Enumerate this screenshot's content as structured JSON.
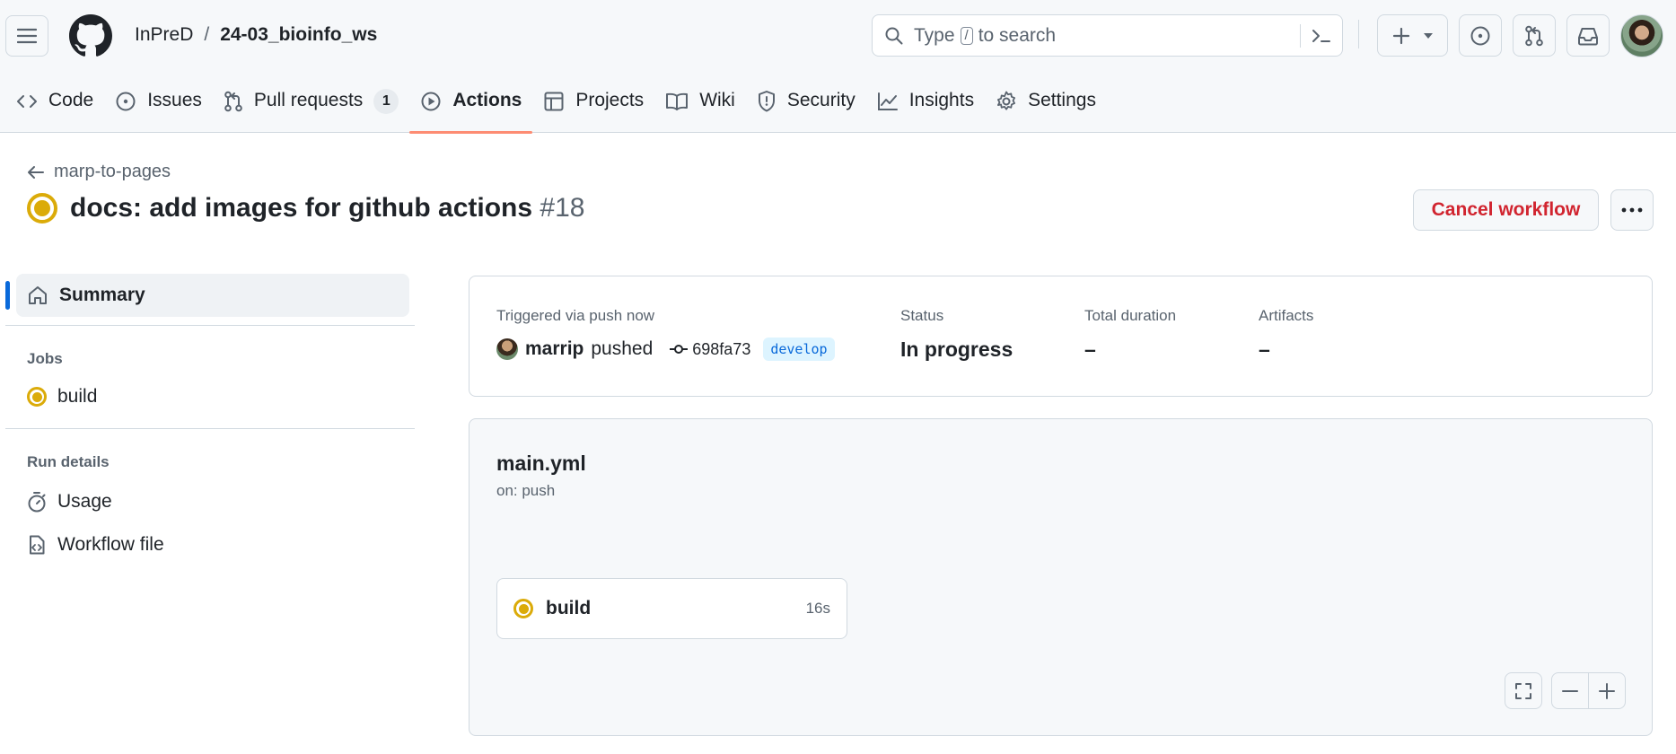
{
  "header": {
    "owner": "InPreD",
    "separator": "/",
    "repo": "24-03_bioinfo_ws",
    "search": {
      "text_before": "Type",
      "kbd": "/",
      "text_after": "to search"
    }
  },
  "tabs": [
    {
      "label": "Code",
      "icon": "code-icon"
    },
    {
      "label": "Issues",
      "icon": "issue-icon"
    },
    {
      "label": "Pull requests",
      "icon": "pull-request-icon",
      "count": "1"
    },
    {
      "label": "Actions",
      "icon": "play-icon",
      "active": true
    },
    {
      "label": "Projects",
      "icon": "table-icon"
    },
    {
      "label": "Wiki",
      "icon": "book-icon"
    },
    {
      "label": "Security",
      "icon": "shield-icon"
    },
    {
      "label": "Insights",
      "icon": "graph-icon"
    },
    {
      "label": "Settings",
      "icon": "gear-icon"
    }
  ],
  "run": {
    "back_label": "marp-to-pages",
    "title": "docs: add images for github actions",
    "number": "#18",
    "cancel_label": "Cancel workflow",
    "status_color": "#dbab09"
  },
  "sidebar": {
    "summary": "Summary",
    "jobs_heading": "Jobs",
    "job": "build",
    "run_details_heading": "Run details",
    "usage": "Usage",
    "workflow_file": "Workflow file"
  },
  "summary": {
    "trigger": "Triggered via push now",
    "actor": "marrip",
    "action": "pushed",
    "commit": "698fa73",
    "branch": "develop",
    "status_label": "Status",
    "status_value": "In progress",
    "duration_label": "Total duration",
    "duration_value": "–",
    "artifacts_label": "Artifacts",
    "artifacts_value": "–"
  },
  "graph": {
    "workflow_name": "main.yml",
    "trigger": "on: push",
    "job_name": "build",
    "job_duration": "16s"
  },
  "colors": {
    "accent": "#0969da",
    "tab_underline": "#fd8c73",
    "danger": "#d1242f",
    "in_progress": "#dbab09"
  }
}
